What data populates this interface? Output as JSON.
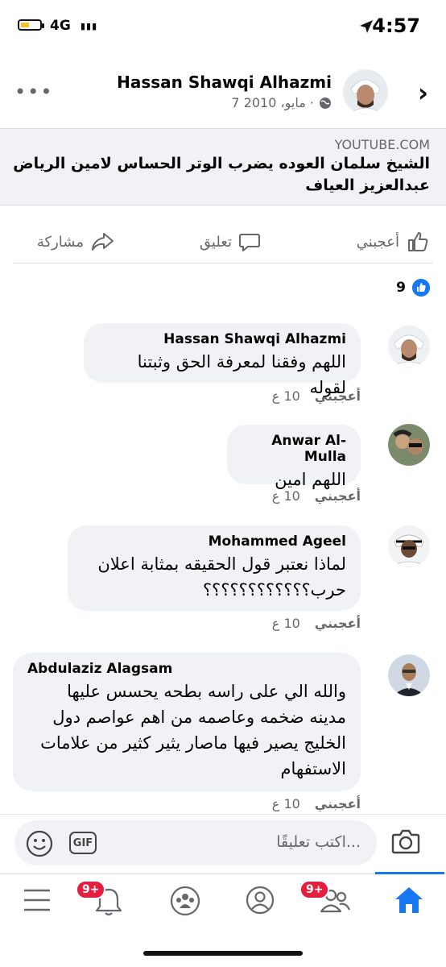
{
  "status_bar": {
    "time": "4:57",
    "carrier": "4G"
  },
  "post": {
    "author": "Hassan Shawqi Alhazmi",
    "date": "7 مايو، 2010 ·",
    "link_domain": "YOUTUBE.COM",
    "link_title": "الشيخ سلمان العوده يضرب الوتر الحساس لامين الرياض عبدالعزيز العياف"
  },
  "actions": {
    "like": "أعجبني",
    "comment": "تعليق",
    "share": "مشاركة"
  },
  "reactions": {
    "count": "9"
  },
  "comments": [
    {
      "name": "Hassan Shawqi Alhazmi",
      "text": "اللهم وفقنا لمعرفة الحق وثبتنا لقوله",
      "time": "10 ع",
      "like": "أعجبني"
    },
    {
      "name": "Anwar Al-Mulla",
      "text": "اللهم امين",
      "time": "10 ع",
      "like": "أعجبني"
    },
    {
      "name": "Mohammed Ageel",
      "text": "لماذا نعتبر قول الحقيقه بمثابة اعلان حرب؟؟؟؟؟؟؟؟؟؟؟؟",
      "time": "10 ع",
      "like": "أعجبني"
    },
    {
      "name": "Abdulaziz Alagsam",
      "text": "والله الي على راسه بطحه يحسس عليها مدينه ضخمه وعاصمه من اهم عواصم دول الخليج يصير فيها ماصار يثير كثير من علامات الاستفهام",
      "time": "10 ع",
      "like": "أعجبني"
    }
  ],
  "composer": {
    "placeholder": "اكتب تعليقًا...",
    "gif_label": "GIF"
  },
  "tabbar": {
    "notifications_badge": "9+",
    "friends_badge": "9+"
  },
  "colors": {
    "brand": "#1877f2",
    "badge": "#e41e3f",
    "bubble": "#f0f2f5"
  }
}
